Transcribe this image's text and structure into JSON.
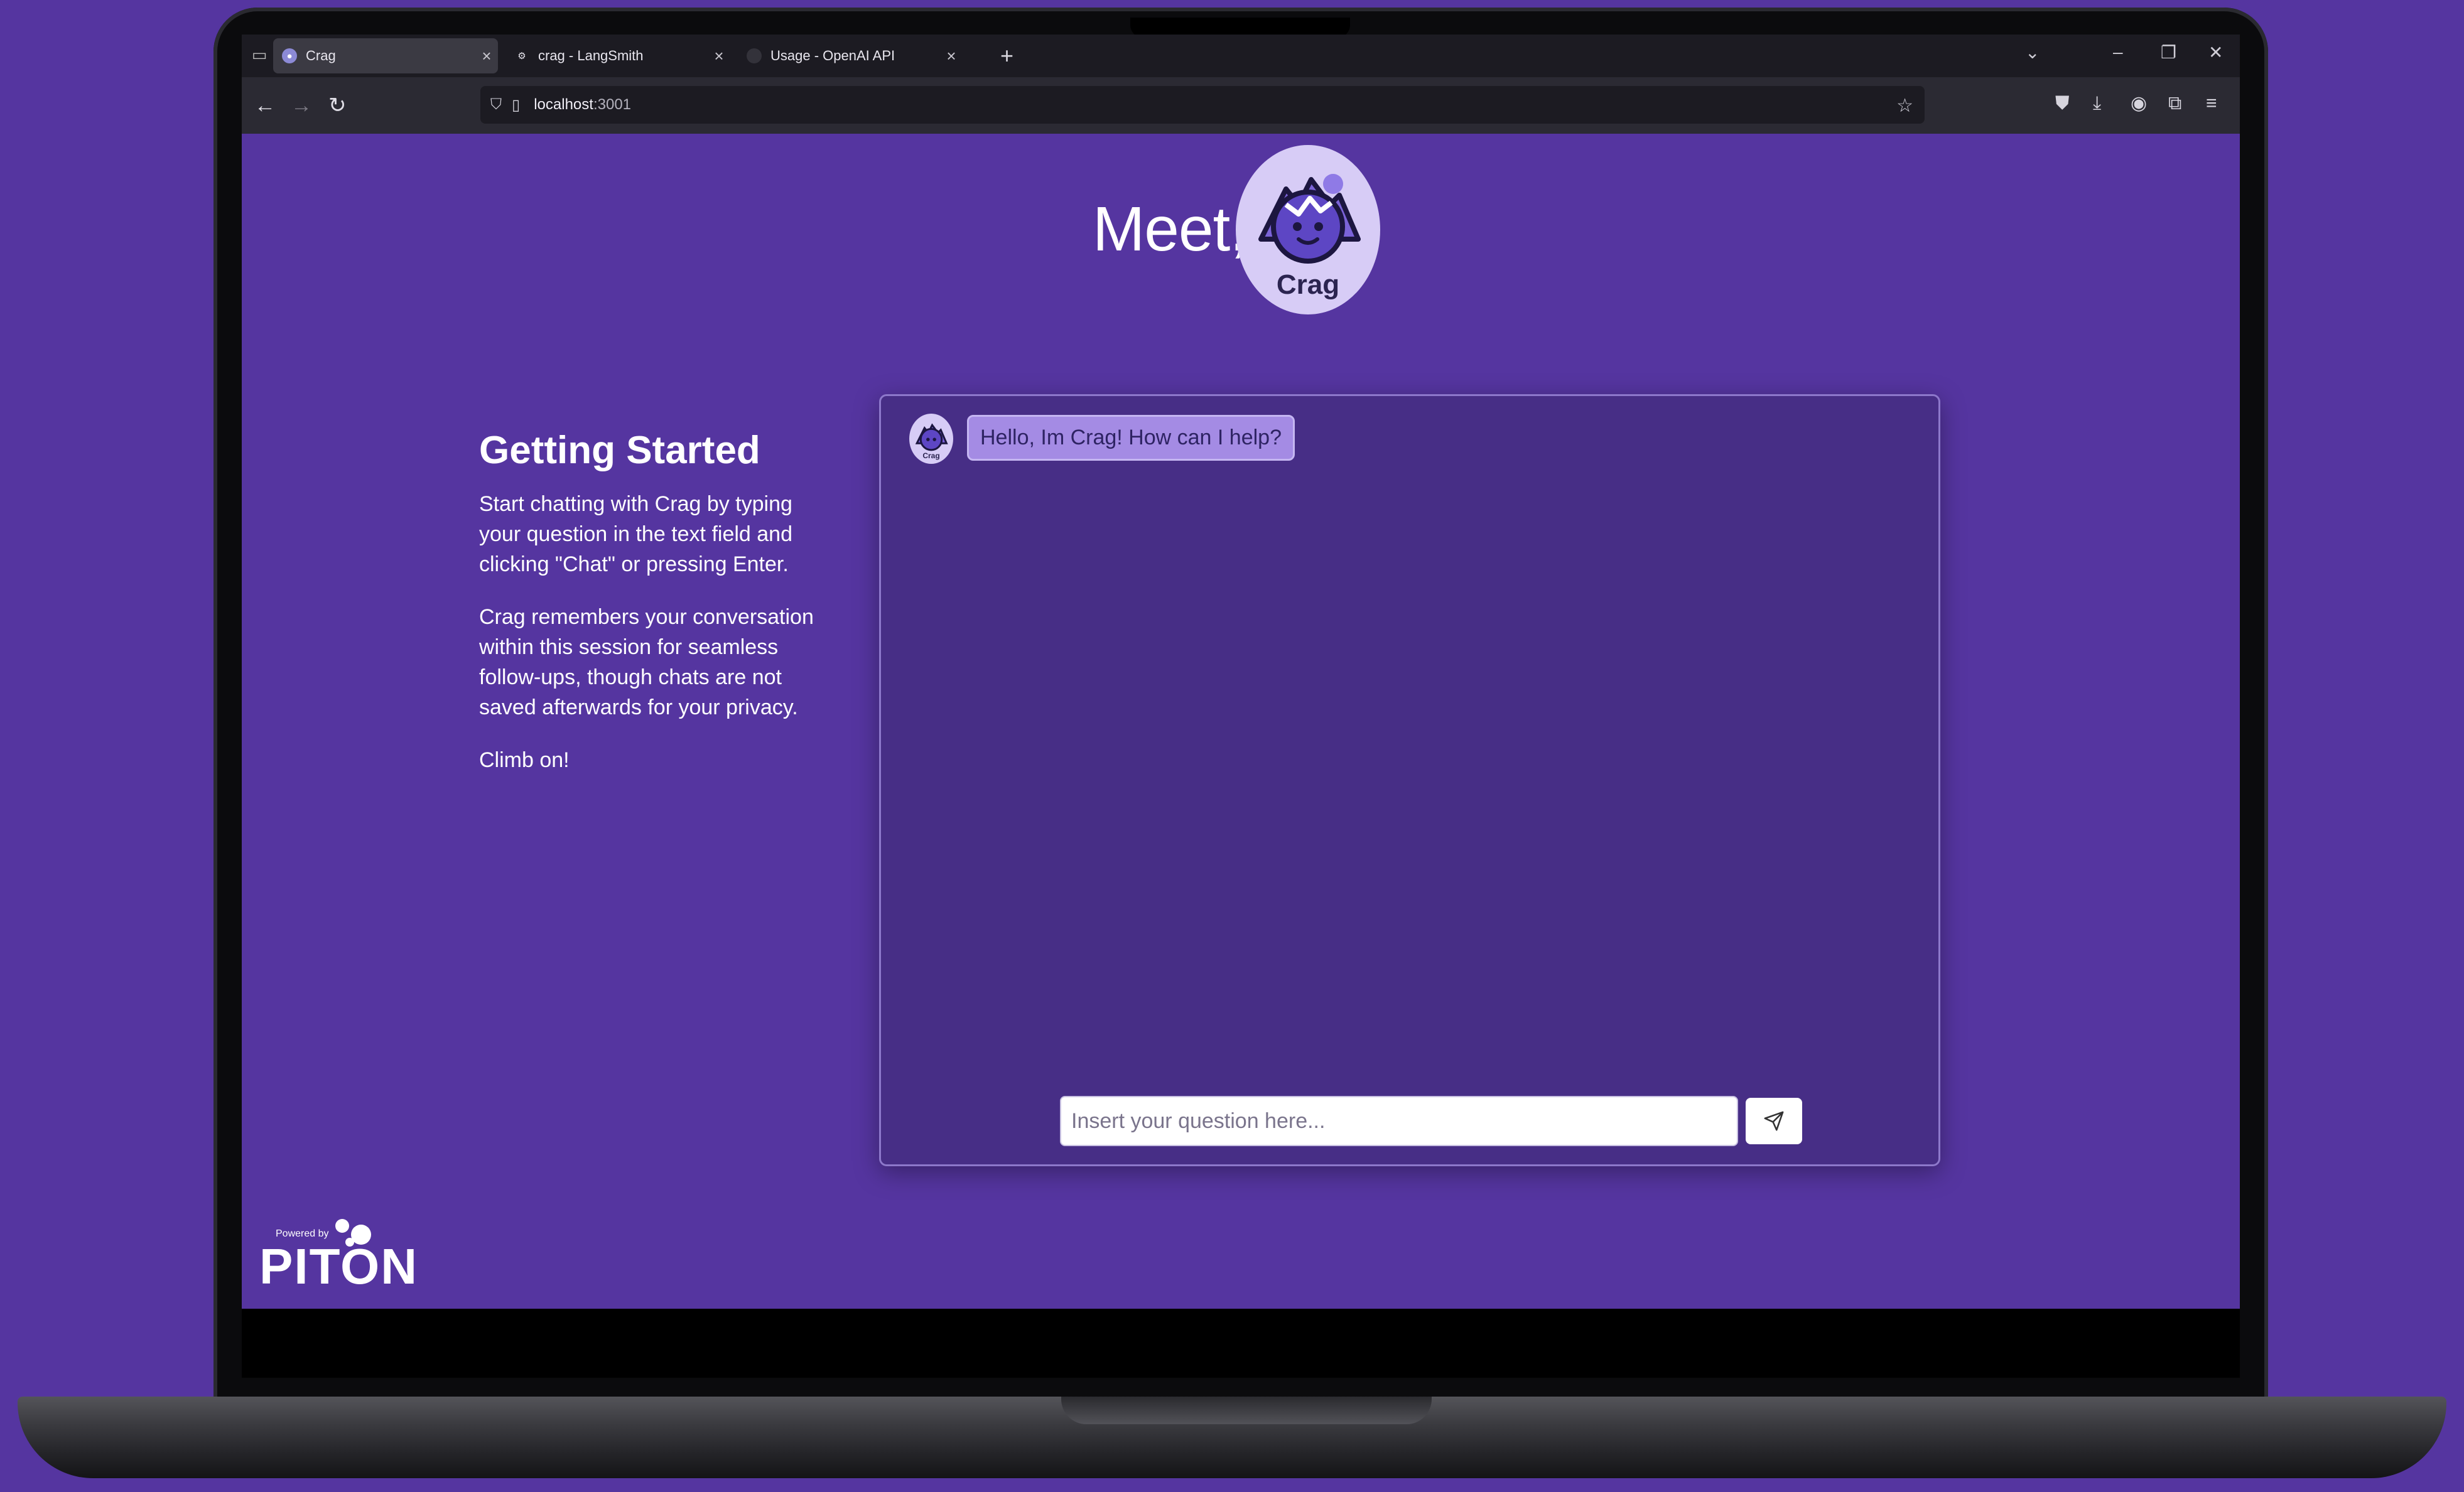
{
  "browser": {
    "tabs": [
      {
        "title": "Crag",
        "active": true,
        "favicon": "crag-favicon"
      },
      {
        "title": "crag - LangSmith",
        "active": false,
        "favicon": "langsmith-favicon"
      },
      {
        "title": "Usage - OpenAI API",
        "active": false,
        "favicon": "openai-favicon"
      }
    ],
    "url_host": "localhost",
    "url_port": ":3001"
  },
  "hero": {
    "title": "Meet,",
    "avatar_name": "Crag"
  },
  "guide": {
    "heading": "Getting Started",
    "paragraphs": [
      "Start chatting with Crag by typing your question in the text field and clicking \"Chat\" or pressing Enter.",
      "Crag remembers your conversation within this session for seamless follow-ups, though chats are not saved afterwards for your privacy.",
      "Climb on!"
    ]
  },
  "chat": {
    "avatar_name": "Crag",
    "messages": [
      {
        "from": "bot",
        "text": "Hello, Im Crag! How can I help?"
      }
    ],
    "input_placeholder": "Insert your question here...",
    "input_value": ""
  },
  "footer": {
    "powered_by": "Powered by",
    "brand": "PITON"
  },
  "colors": {
    "page_bg": "#5535a0",
    "chat_bg": "#472e86",
    "bubble_bg": "#a48be4",
    "avatar_bg": "#d7ccf6"
  }
}
